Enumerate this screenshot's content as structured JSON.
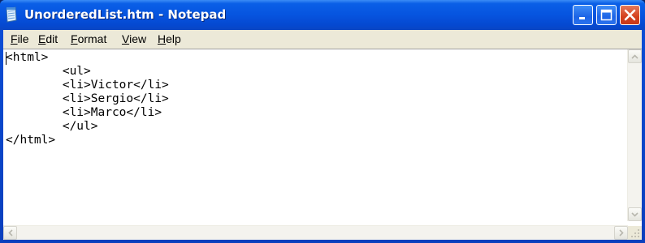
{
  "window": {
    "title": "UnorderedList.htm - Notepad"
  },
  "menu": {
    "file": {
      "mnemonic": "F",
      "rest": "ile"
    },
    "edit": {
      "mnemonic": "E",
      "rest": "dit"
    },
    "format": {
      "mnemonic": "F",
      "rest": "ormat",
      "prefix": "F",
      "label": "Format"
    },
    "view": {
      "mnemonic": "V",
      "rest": "iew"
    },
    "help": {
      "mnemonic": "H",
      "rest": "elp"
    }
  },
  "document": {
    "content": "<html>\n\t<ul>\n\t<li>Victor</li>\n\t<li>Sergio</li>\n\t<li>Marco</li>\n\t</ul>\n</html>"
  },
  "icons": {
    "app": "notepad-icon",
    "minimize": "minimize-icon",
    "maximize": "maximize-icon",
    "close": "close-icon"
  },
  "colors": {
    "titlebar": "#0654df",
    "close_button": "#d4401d",
    "menu_background": "#ece9d8"
  }
}
